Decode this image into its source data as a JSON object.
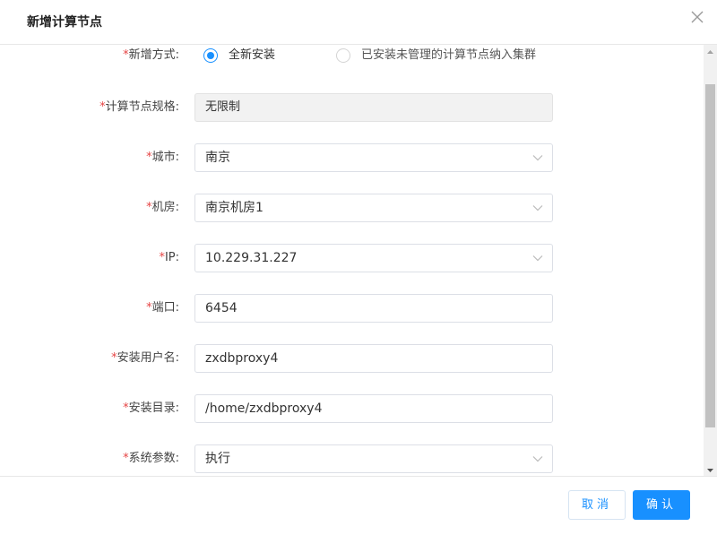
{
  "dialog": {
    "title": "新增计算节点",
    "close_icon": "close-icon"
  },
  "form": {
    "required_mark": "*",
    "install_mode": {
      "label": "新增方式:",
      "options": [
        "全新安装",
        "已安装未管理的计算节点纳入集群"
      ],
      "selected": "全新安装"
    },
    "spec": {
      "label": "计算节点规格:",
      "value": "无限制"
    },
    "city": {
      "label": "城市:",
      "value": "南京"
    },
    "room": {
      "label": "机房:",
      "value": "南京机房1"
    },
    "ip": {
      "label": "IP:",
      "value": "10.229.31.227"
    },
    "port": {
      "label": "端口:",
      "value": "6454"
    },
    "install_user": {
      "label": "安装用户名:",
      "value": "zxdbproxy4"
    },
    "install_dir": {
      "label": "安装目录:",
      "value": "/home/zxdbproxy4"
    },
    "sys_params": {
      "label": "系统参数:",
      "value": "执行"
    }
  },
  "footer": {
    "cancel_label": "取消",
    "confirm_label": "确认"
  },
  "colors": {
    "primary": "#1890ff",
    "required": "#e64545"
  }
}
